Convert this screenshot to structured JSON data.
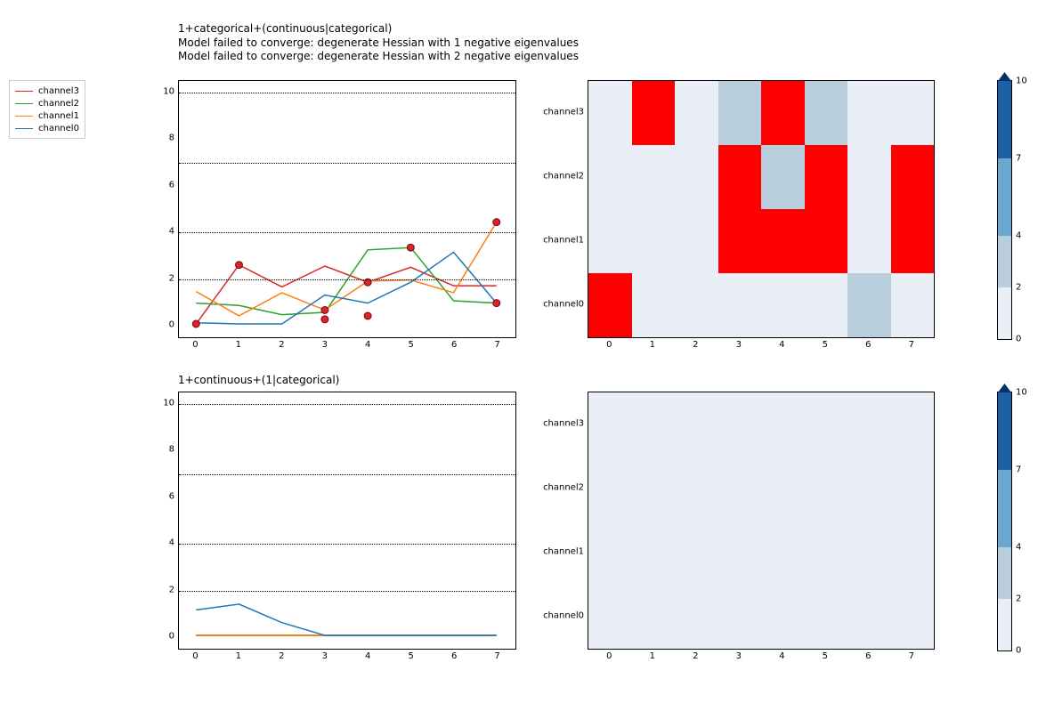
{
  "chart_data": [
    {
      "type": "line",
      "title": "1+categorical+(continuous|categorical)",
      "warnings": [
        "Model failed to converge: degenerate  Hessian with 1 negative eigenvalues",
        "Model failed to converge: degenerate  Hessian with 2 negative eigenvalues"
      ],
      "x": [
        0,
        1,
        2,
        3,
        4,
        5,
        6,
        7
      ],
      "ylim": [
        -0.5,
        10.5
      ],
      "yticks": [
        0,
        2,
        4,
        6,
        8,
        10
      ],
      "hlines": [
        2,
        4,
        7,
        10
      ],
      "series": [
        {
          "name": "channel3",
          "color": "#d62728",
          "values": [
            0.0,
            2.55,
            1.6,
            2.5,
            1.8,
            2.45,
            1.65,
            1.65
          ]
        },
        {
          "name": "channel2",
          "color": "#2ca02c",
          "values": [
            0.9,
            0.8,
            0.4,
            0.5,
            3.2,
            3.3,
            1.0,
            0.9
          ]
        },
        {
          "name": "channel1",
          "color": "#ff7f0e",
          "values": [
            1.4,
            0.35,
            1.35,
            0.6,
            1.85,
            1.9,
            1.35,
            4.4
          ]
        },
        {
          "name": "channel0",
          "color": "#1f77b4",
          "values": [
            0.05,
            0.0,
            0.0,
            1.25,
            0.9,
            1.8,
            3.1,
            0.9
          ]
        }
      ],
      "points": {
        "color": "#d62728",
        "values": [
          0.0,
          2.55,
          null,
          0.6,
          1.8,
          3.3,
          null,
          4.4
        ]
      },
      "extra_points": [
        {
          "x": 3,
          "y": 0.2
        },
        {
          "x": 4,
          "y": 0.35
        },
        {
          "x": 7,
          "y": 0.9
        }
      ]
    },
    {
      "type": "heatmap",
      "x": [
        0,
        1,
        2,
        3,
        4,
        5,
        6,
        7
      ],
      "ylabels": [
        "channel0",
        "channel1",
        "channel2",
        "channel3"
      ],
      "colors": [
        [
          "red",
          "bg",
          "bg",
          "bg",
          "bg",
          "bg",
          "mid",
          "bg"
        ],
        [
          "bg",
          "bg",
          "bg",
          "red",
          "red",
          "red",
          "bg",
          "red"
        ],
        [
          "bg",
          "bg",
          "bg",
          "red",
          "mid",
          "red",
          "bg",
          "red"
        ],
        [
          "bg",
          "red",
          "bg",
          "mid",
          "red",
          "mid",
          "bg",
          "bg"
        ]
      ],
      "colorbar": {
        "ticks": [
          0,
          2,
          4,
          7,
          10
        ]
      }
    },
    {
      "type": "line",
      "title": "1+continuous+(1|categorical)",
      "x": [
        0,
        1,
        2,
        3,
        4,
        5,
        6,
        7
      ],
      "ylim": [
        -0.5,
        10.5
      ],
      "yticks": [
        0,
        2,
        4,
        6,
        8,
        10
      ],
      "hlines": [
        2,
        4,
        7,
        10
      ],
      "series": [
        {
          "name": "channel3",
          "color": "#d62728",
          "values": [
            0,
            0,
            0,
            0,
            0,
            0,
            0,
            0
          ]
        },
        {
          "name": "channel2",
          "color": "#2ca02c",
          "values": [
            0,
            0,
            0,
            0,
            0,
            0,
            0,
            0
          ]
        },
        {
          "name": "channel1",
          "color": "#ff7f0e",
          "values": [
            0,
            0,
            0,
            0,
            0,
            0,
            0,
            0
          ]
        },
        {
          "name": "channel0",
          "color": "#1f77b4",
          "values": [
            1.1,
            1.35,
            0.55,
            0.0,
            0,
            0,
            0,
            0
          ]
        }
      ]
    },
    {
      "type": "heatmap",
      "x": [
        0,
        1,
        2,
        3,
        4,
        5,
        6,
        7
      ],
      "ylabels": [
        "channel0",
        "channel1",
        "channel2",
        "channel3"
      ],
      "colors": [
        [
          "bg",
          "bg",
          "bg",
          "bg",
          "bg",
          "bg",
          "bg",
          "bg"
        ],
        [
          "bg",
          "bg",
          "bg",
          "bg",
          "bg",
          "bg",
          "bg",
          "bg"
        ],
        [
          "bg",
          "bg",
          "bg",
          "bg",
          "bg",
          "bg",
          "bg",
          "bg"
        ],
        [
          "bg",
          "bg",
          "bg",
          "bg",
          "bg",
          "bg",
          "bg",
          "bg"
        ]
      ],
      "colorbar": {
        "ticks": [
          0,
          2,
          4,
          7,
          10
        ]
      }
    }
  ],
  "legend": {
    "items": [
      {
        "label": "channel3",
        "color": "#d62728"
      },
      {
        "label": "channel2",
        "color": "#2ca02c"
      },
      {
        "label": "channel1",
        "color": "#ff7f0e"
      },
      {
        "label": "channel0",
        "color": "#1f77b4"
      }
    ]
  },
  "palette": {
    "bg": "#eaeef7",
    "mid": "#b9cedd",
    "red": "#ff0000"
  },
  "cbar_palette": [
    {
      "from": 0,
      "to": 2,
      "color": "#eaeef7"
    },
    {
      "from": 2,
      "to": 4,
      "color": "#b9cedd"
    },
    {
      "from": 4,
      "to": 7,
      "color": "#6aa8cf"
    },
    {
      "from": 7,
      "to": 10,
      "color": "#1e5fa5"
    }
  ]
}
